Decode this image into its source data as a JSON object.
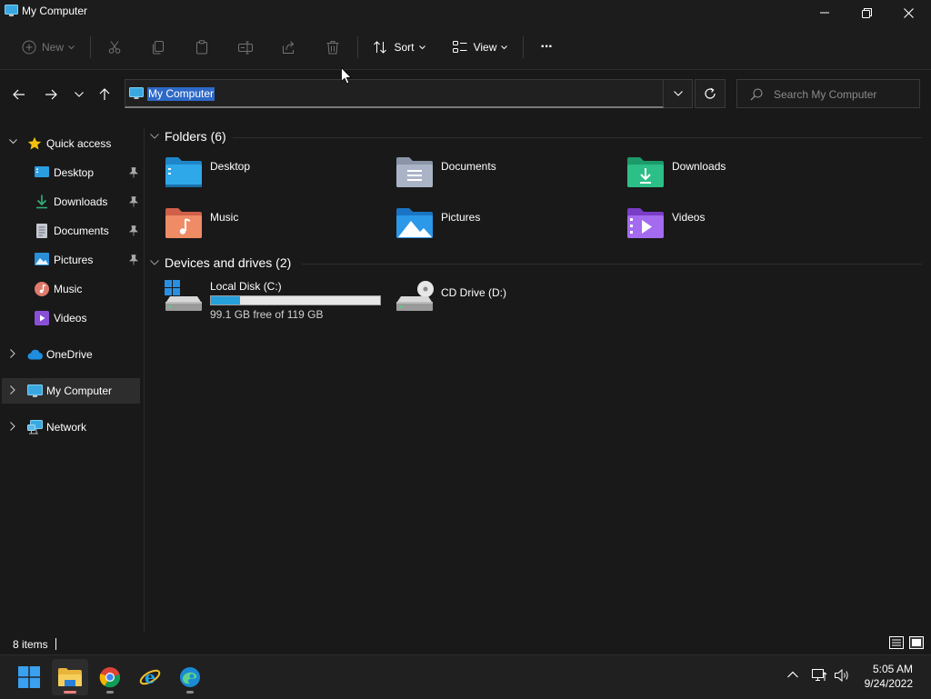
{
  "window": {
    "title": "My Computer"
  },
  "toolbar": {
    "new_label": "New",
    "sort_label": "Sort",
    "view_label": "View",
    "more_label": "···"
  },
  "address": {
    "path": "My Computer"
  },
  "search": {
    "placeholder": "Search My Computer"
  },
  "sidebar": {
    "quick_access": "Quick access",
    "items": [
      {
        "label": "Desktop",
        "icon": "desktop-icon",
        "pinned": true
      },
      {
        "label": "Downloads",
        "icon": "downloads-icon",
        "pinned": true
      },
      {
        "label": "Documents",
        "icon": "documents-icon",
        "pinned": true
      },
      {
        "label": "Pictures",
        "icon": "pictures-icon",
        "pinned": true
      },
      {
        "label": "Music",
        "icon": "music-icon",
        "pinned": false
      },
      {
        "label": "Videos",
        "icon": "videos-icon",
        "pinned": false
      }
    ],
    "onedrive": "OneDrive",
    "mycomputer": "My Computer",
    "network": "Network"
  },
  "content": {
    "folders_header": "Folders (6)",
    "folders": [
      {
        "label": "Desktop",
        "icon": "desktop-folder-icon"
      },
      {
        "label": "Documents",
        "icon": "documents-folder-icon"
      },
      {
        "label": "Downloads",
        "icon": "downloads-folder-icon"
      },
      {
        "label": "Music",
        "icon": "music-folder-icon"
      },
      {
        "label": "Pictures",
        "icon": "pictures-folder-icon"
      },
      {
        "label": "Videos",
        "icon": "videos-folder-icon"
      }
    ],
    "drives_header": "Devices and drives (2)",
    "drives": [
      {
        "label": "Local Disk (C:)",
        "free_text": "99.1 GB free of 119 GB",
        "used_fraction": 0.17
      },
      {
        "label": "CD Drive (D:)"
      }
    ]
  },
  "status": {
    "items": "8 items"
  },
  "taskbar": {
    "apps": [
      "start-icon",
      "file-explorer-icon",
      "chrome-icon",
      "internet-explorer-icon",
      "edge-icon"
    ],
    "time": "5:05 AM",
    "date": "9/24/2022"
  },
  "colors": {
    "accent": "#26a0da",
    "selection": "#2e69c6",
    "background": "#191919"
  }
}
